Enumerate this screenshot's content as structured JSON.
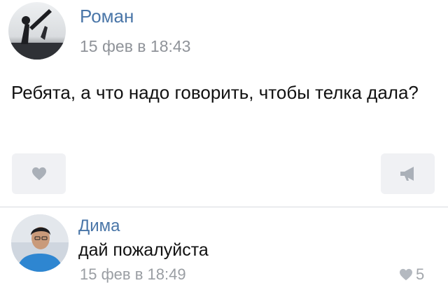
{
  "post": {
    "author": "Роман",
    "date": "15 фев в 18:43",
    "text": "Ребята, а что надо говорить, чтобы телка дала?",
    "actions": {
      "like_icon": "heart-icon",
      "share_icon": "megaphone-icon"
    }
  },
  "comment": {
    "author": "Дима",
    "text": "дай пожалуйста",
    "date": "15 фев в 18:49",
    "likes": "5"
  },
  "colors": {
    "author_link": "#4a76a8",
    "meta_text": "#8f9399",
    "button_bg": "#f0f1f4",
    "icon": "#aab0b8"
  }
}
